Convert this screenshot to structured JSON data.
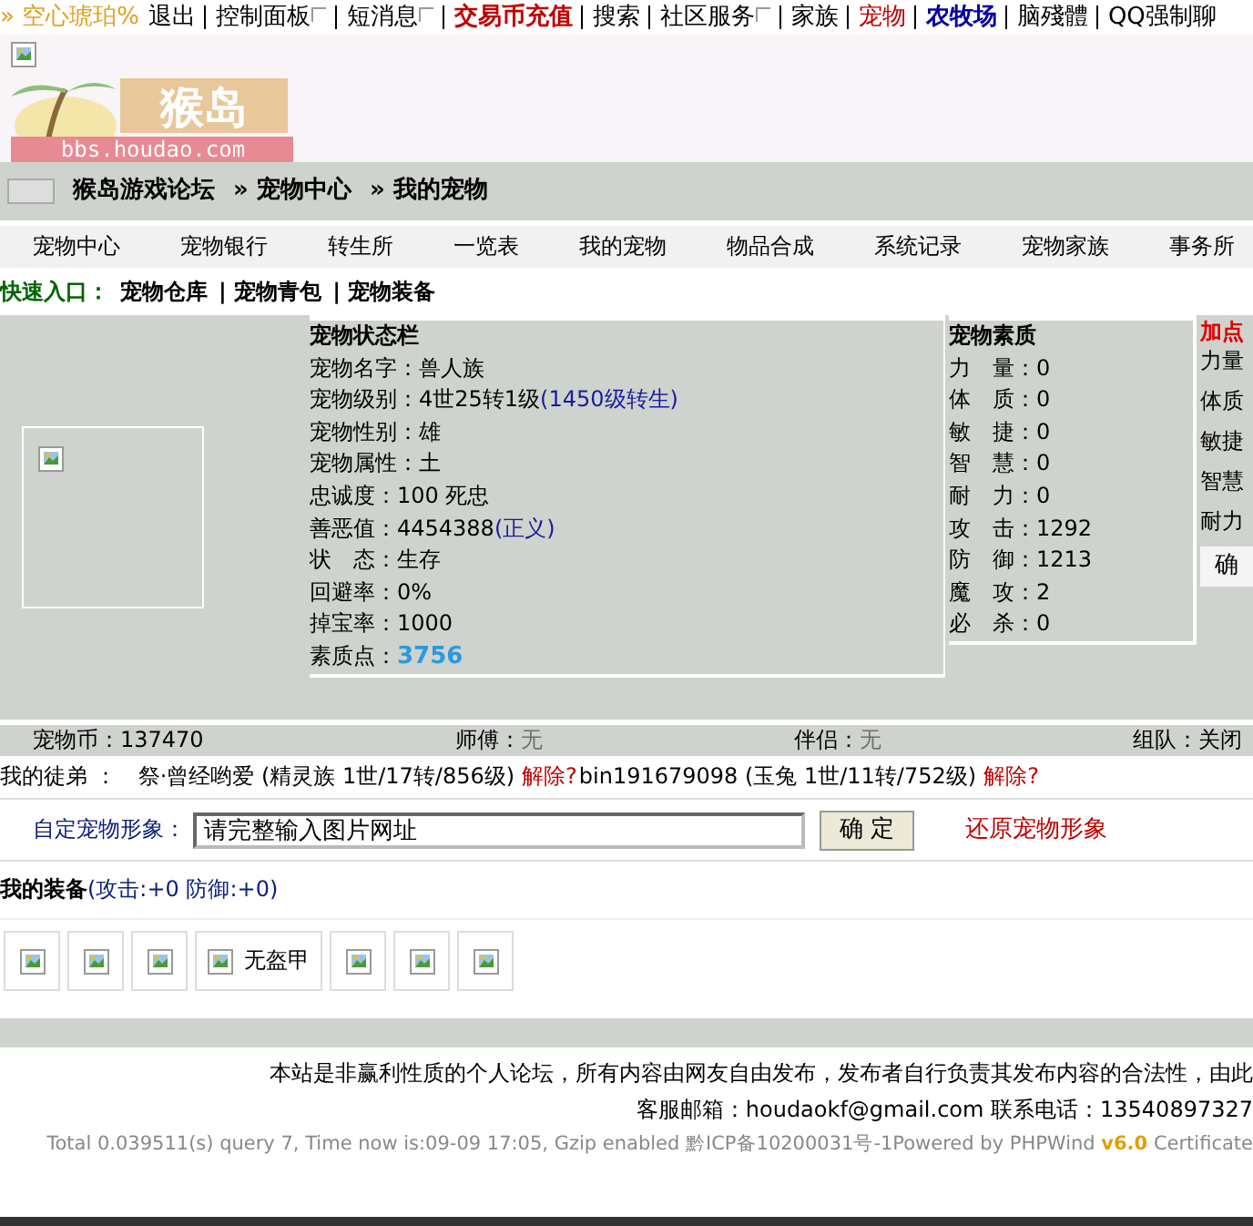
{
  "top_nav": [
    {
      "label": "» 空心琥珀%",
      "kind": "user",
      "dropdown": false
    },
    {
      "label": "退出",
      "kind": "plain",
      "dropdown": false
    },
    {
      "label": "控制面板",
      "kind": "plain",
      "dropdown": true
    },
    {
      "label": "短消息",
      "kind": "plain",
      "dropdown": true
    },
    {
      "label": "交易币充值",
      "kind": "hot",
      "dropdown": false
    },
    {
      "label": "搜索",
      "kind": "plain",
      "dropdown": false
    },
    {
      "label": "社区服务",
      "kind": "plain",
      "dropdown": true
    },
    {
      "label": "家族",
      "kind": "plain",
      "dropdown": false
    },
    {
      "label": "宠物",
      "kind": "current",
      "dropdown": false
    },
    {
      "label": "农牧场",
      "kind": "farm",
      "dropdown": false
    },
    {
      "label": "脑殘體",
      "kind": "plain",
      "dropdown": false
    },
    {
      "label": "QQ强制聊",
      "kind": "plain",
      "dropdown": false
    }
  ],
  "logo": {
    "title": "猴岛",
    "url": "bbs.houdao.com"
  },
  "breadcrumb": [
    "猴岛游戏论坛",
    "» 宠物中心",
    "» 我的宠物"
  ],
  "menu": [
    "宠物中心",
    "宠物银行",
    "转生所",
    "一览表",
    "我的宠物",
    "物品合成",
    "系统记录",
    "宠物家族",
    "事务所"
  ],
  "quick_entry": {
    "label": "快速入口：",
    "links": [
      "宠物仓库",
      "| 宠物青包",
      "| 宠物装备"
    ]
  },
  "status": {
    "title": "宠物状态栏",
    "rows": [
      {
        "text": "宠物名字：兽人族",
        "kind": "plain"
      },
      {
        "text": "宠物级别：4世25转1级",
        "note": "(1450级转生)",
        "kind": "note"
      },
      {
        "text": "宠物性别：雄",
        "kind": "plain"
      },
      {
        "text": "宠物属性：土",
        "kind": "plain"
      },
      {
        "text": "忠诚度：100 死忠",
        "kind": "plain"
      },
      {
        "text": "善恶值：4454388",
        "note": "(正义)",
        "kind": "note"
      },
      {
        "text": "状　态：生存",
        "kind": "plain"
      },
      {
        "text": "回避率：0%",
        "kind": "plain"
      },
      {
        "text": "掉宝率：1000",
        "kind": "plain"
      },
      {
        "text": "素质点：",
        "note": "3756",
        "kind": "highlight"
      }
    ]
  },
  "quality": {
    "title": "宠物素质",
    "rows": [
      "力　量：0",
      "体　质：0",
      "敏　捷：0",
      "智　慧：0",
      "耐　力：0",
      "攻　击：1292",
      "防　御：1213",
      "魔　攻：2",
      "必　杀：0"
    ]
  },
  "add_points": {
    "title": "加点",
    "rows": [
      "力量",
      "体质",
      "敏捷",
      "智慧",
      "耐力"
    ],
    "button": "确"
  },
  "summary": [
    {
      "label": "宠物币：",
      "value": "137470",
      "muted": false
    },
    {
      "label": "师傅：",
      "value": "无",
      "muted": true
    },
    {
      "label": "伴侣：",
      "value": "无",
      "muted": true
    },
    {
      "label": "组队：",
      "value": "关闭",
      "muted": false
    }
  ],
  "disciples": {
    "label": "我的徒弟 ：",
    "items": [
      {
        "text": "祭·曾经哟爱 (精灵族  1世/17转/856级)",
        "action": "解除?"
      },
      {
        "text": "bin191679098 (玉兔  1世/11转/752级)",
        "action": "解除?"
      }
    ]
  },
  "custom_image": {
    "label": "自定宠物形象：",
    "value": "请完整输入图片网址",
    "button": "确 定",
    "reset": "还原宠物形象"
  },
  "equipment": {
    "title": "我的装备",
    "stats": "(攻击:+0 防御:+0)",
    "slots": [
      {
        "kind": "empty"
      },
      {
        "kind": "empty"
      },
      {
        "kind": "empty"
      },
      {
        "kind": "labeled",
        "label": "无盔甲"
      },
      {
        "kind": "empty"
      },
      {
        "kind": "empty"
      },
      {
        "kind": "empty"
      }
    ]
  },
  "footer": [
    "本站是非赢利性质的个人论坛，所有内容由网友自由发布，发布者自行负责其发布内容的合法性，由此",
    "客服邮箱：houdaokf@gmail.com 联系电话：13540897327",
    "Total 0.039511(s) query 7, Time now is:09-09 17:05, Gzip enabled 黔ICP备10200031号-1Powered by PHPWind **v6.0** Certificate"
  ]
}
